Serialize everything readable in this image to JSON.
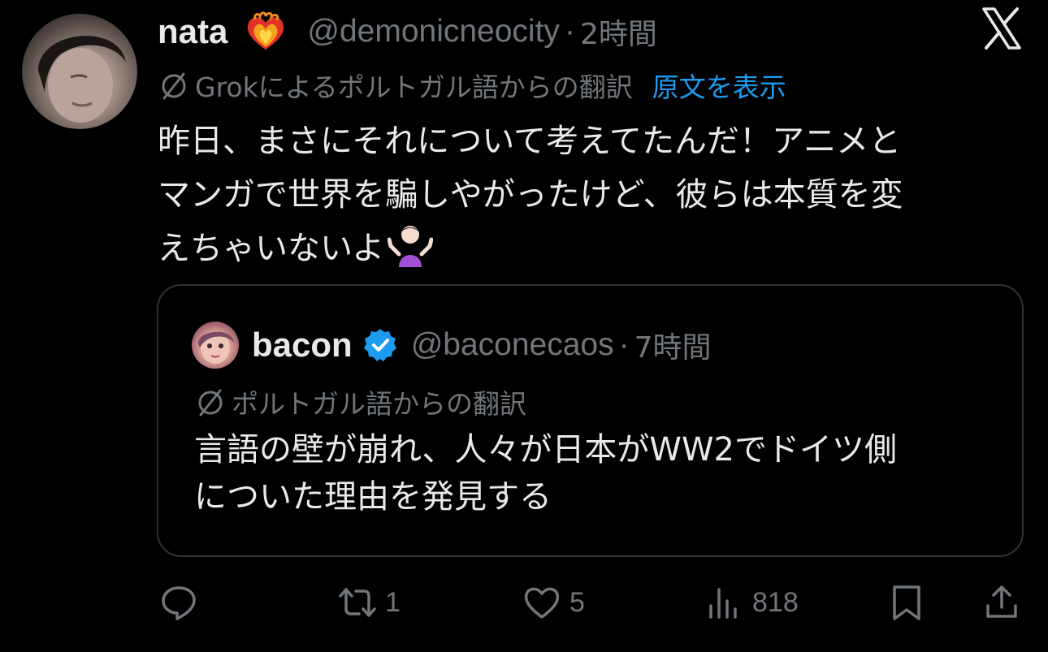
{
  "tweet": {
    "display_name": "nata",
    "name_emoji": "heart-on-fire-emoji",
    "handle": "@demonicneocity",
    "separator": "·",
    "time": "2時間",
    "translation_label": "Grokによるポルトガル語からの翻訳",
    "show_original": "原文を表示",
    "body_lines": [
      "昨日、まさにそれについて考えてたんだ！アニメと",
      "マンガで世界を騙しやがったけど、彼らは本質を変",
      "えちゃいないよ"
    ],
    "body_emoji": "person-shrugging-emoji"
  },
  "quote": {
    "display_name": "bacon",
    "verified": true,
    "handle": "@baconecaos",
    "separator": "·",
    "time": "7時間",
    "translation_label": "ポルトガル語からの翻訳",
    "body_lines": [
      "言語の壁が崩れ、人々が日本がWW2でドイツ側",
      "についた理由を発見する"
    ]
  },
  "actions": {
    "reply_count": "",
    "retweet_count": "1",
    "like_count": "5",
    "views_count": "818"
  },
  "icons": {
    "brand": "x-logo-icon",
    "translate": "translate-icon",
    "verified": "verified-badge-icon",
    "reply": "reply-icon",
    "retweet": "retweet-icon",
    "like": "heart-icon",
    "views": "views-icon",
    "bookmark": "bookmark-icon",
    "share": "share-icon"
  },
  "colors": {
    "background": "#000000",
    "text_primary": "#e7e9ea",
    "text_secondary": "#71767b",
    "link": "#1d9bf0",
    "verified": "#1d9bf0",
    "card_border": "#2f3336"
  }
}
